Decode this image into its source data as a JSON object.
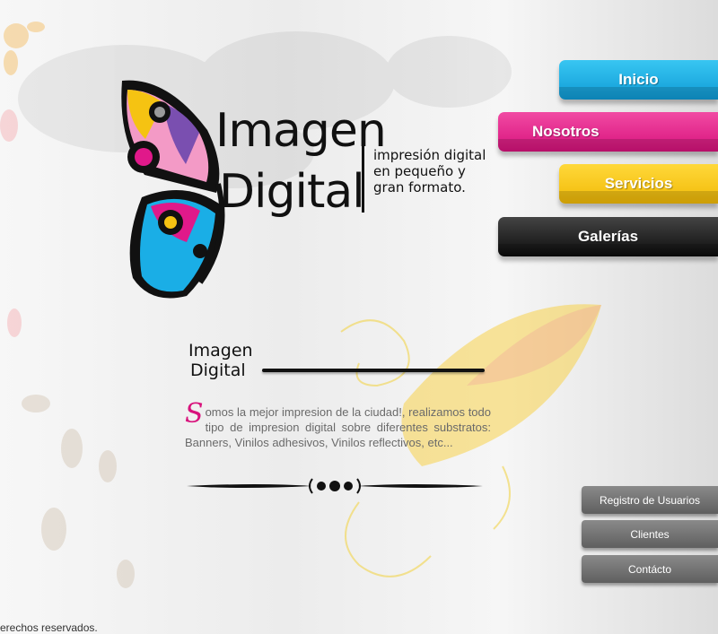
{
  "logo": {
    "brand_line1": "Imagen",
    "brand_line2": "Digital",
    "tagline": [
      "impresión digital",
      "en pequeño y",
      "gran formato."
    ]
  },
  "nav": {
    "inicio": "Inicio",
    "nosotros": "Nosotros",
    "servicios": "Servicios",
    "galerias": "Galerías"
  },
  "content": {
    "mini_logo_line1": "Imagen",
    "mini_logo_line2": "Digital",
    "dropcap": "S",
    "intro_text": "omos la mejor impresion de la ciudad!, realizamos todo tipo de impresion digital sobre diferentes substratos: Banners, Vinilos adhesivos, Vinilos reflectivos, etc..."
  },
  "side_links": {
    "registro": "Registro de Usuarios",
    "clientes": "Clientes",
    "contacto": "Contácto"
  },
  "footer": {
    "text": "erechos reservados."
  },
  "colors": {
    "cyan": "#1aaee6",
    "magenta": "#e0198a",
    "yellow": "#f5c312",
    "black": "#111111",
    "gray_button": "#737373"
  }
}
